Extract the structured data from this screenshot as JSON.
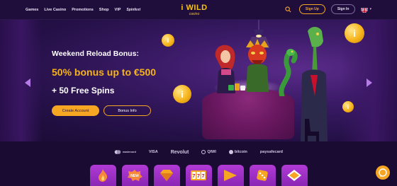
{
  "nav": {
    "items": [
      "Games",
      "Live Casino",
      "Promotions",
      "Shop",
      "VIP"
    ],
    "tournament_label": "Spinfest"
  },
  "logo": {
    "main": "i WILD",
    "sub": "casino"
  },
  "header": {
    "signup_label": "Sign Up",
    "signin_label": "Sign In"
  },
  "hero": {
    "line1": "Weekend Reload Bonus:",
    "line2": "50% bonus up to €500",
    "line3": "+ 50 Free Spins",
    "create_account_label": "Create Account",
    "bonus_info_label": "Bonus Info"
  },
  "payments": {
    "mastercard": "mastercard",
    "visa": "VISA",
    "revolut": "Revolut",
    "qiwi": "QIWI",
    "bitcoin": "bitcoin",
    "paysafecard": "paysafecard"
  },
  "categories": [
    "fire-icon",
    "new-icon",
    "diamond-icon",
    "slot-777-icon",
    "play-icon",
    "dice-icon",
    "card-icon"
  ],
  "colors": {
    "accent": "#f6a623",
    "bg": "#1a0b33",
    "category": "#a032c8"
  }
}
